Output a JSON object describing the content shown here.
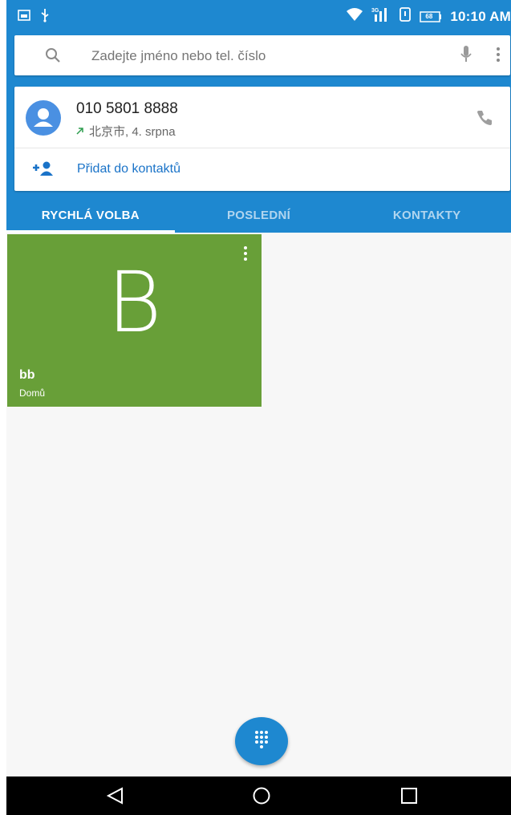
{
  "status_bar": {
    "time": "10:10 AM",
    "battery": "68",
    "network": "3G"
  },
  "search": {
    "placeholder": "Zadejte jméno nebo tel. číslo"
  },
  "result": {
    "number": "010 5801 8888",
    "location_date": "北京市, 4. srpna",
    "add_contact_label": "Přidat do kontaktů"
  },
  "tabs": [
    {
      "label": "RYCHLÁ VOLBA",
      "active": true
    },
    {
      "label": "POSLEDNÍ",
      "active": false
    },
    {
      "label": "KONTAKTY",
      "active": false
    }
  ],
  "speed_dial": {
    "letter": "B",
    "name": "bb",
    "label": "Domů",
    "color": "#689f38"
  },
  "colors": {
    "primary": "#1e88d0",
    "tile": "#689f38",
    "link": "#1a73c8"
  },
  "icons": [
    "sim-icon",
    "usb-icon",
    "wifi-icon",
    "signal-icon",
    "battery-icon",
    "search-icon",
    "mic-icon",
    "overflow-menu-icon",
    "avatar-icon",
    "outgoing-call-arrow-icon",
    "phone-icon",
    "add-person-icon",
    "dialpad-icon",
    "back-icon",
    "home-icon",
    "recent-apps-icon"
  ]
}
